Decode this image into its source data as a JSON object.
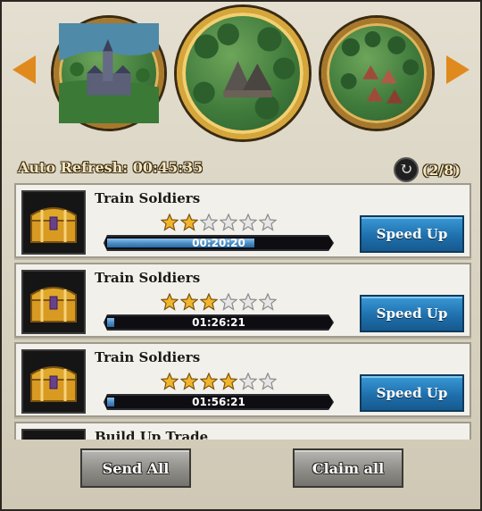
{
  "header": {
    "auto_refresh_label": "Auto Refresh: 00:45:35",
    "refresh_count": "(2/8)"
  },
  "locations": [
    {
      "icon": "castle-town-icon"
    },
    {
      "icon": "forest-camp-icon",
      "selected": true
    },
    {
      "icon": "forest-village-icon"
    }
  ],
  "tasks": [
    {
      "title": "Train Soldiers",
      "stars": 2,
      "max_stars": 6,
      "time": "00:20:20",
      "progress": 0.66,
      "button": "Speed Up"
    },
    {
      "title": "Train Soldiers",
      "stars": 3,
      "max_stars": 6,
      "time": "01:26:21",
      "progress": 0.03,
      "button": "Speed Up"
    },
    {
      "title": "Train Soldiers",
      "stars": 4,
      "max_stars": 6,
      "time": "01:56:21",
      "progress": 0.03,
      "button": "Speed Up"
    },
    {
      "title": "Build Up Trade",
      "stars": 0,
      "max_stars": 6,
      "time": "",
      "progress": 0,
      "button": ""
    }
  ],
  "actions": {
    "send_all": "Send All",
    "claim_all": "Claim all"
  },
  "colors": {
    "accent_orange": "#e08a1e",
    "speed_blue": "#1f70ad",
    "star_gold": "#f0b52a"
  }
}
